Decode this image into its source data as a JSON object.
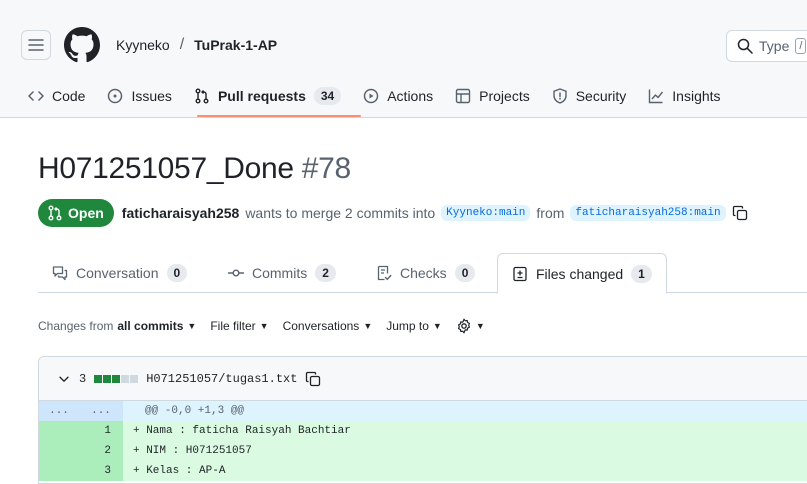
{
  "header": {
    "owner": "Kyyneko",
    "separator": "/",
    "repo": "TuPrak-1-AP",
    "search_placeholder": "Type",
    "search_key": "/"
  },
  "nav": {
    "code": "Code",
    "issues": "Issues",
    "pull_requests": "Pull requests",
    "pull_requests_count": "34",
    "actions": "Actions",
    "projects": "Projects",
    "security": "Security",
    "insights": "Insights"
  },
  "pr": {
    "title": "H071251057_Done",
    "number": "#78",
    "state": "Open",
    "author": "faticharaisyah258",
    "merge_text": "wants to merge 2 commits into",
    "base_branch": "Kyyneko:main",
    "from_text": "from",
    "head_branch": "faticharaisyah258:main"
  },
  "tabs": {
    "conversation": "Conversation",
    "conversation_count": "0",
    "commits": "Commits",
    "commits_count": "2",
    "checks": "Checks",
    "checks_count": "0",
    "files": "Files changed",
    "files_count": "1"
  },
  "toolbar": {
    "changes_from": "Changes from",
    "all_commits": "all commits",
    "file_filter": "File filter",
    "conversations": "Conversations",
    "jump_to": "Jump to"
  },
  "file": {
    "changes": "3",
    "path": "H071251057/tugas1.txt",
    "hunk_left": "...",
    "hunk_right": "...",
    "hunk_header": "@@ -0,0 +1,3 @@",
    "lines": [
      {
        "num": "1",
        "text": "+ Nama : faticha Raisyah Bachtiar"
      },
      {
        "num": "2",
        "text": "+ NIM : H071251057"
      },
      {
        "num": "3",
        "text": "+ Kelas : AP-A"
      }
    ]
  },
  "colors": {
    "open_green": "#1f883d",
    "branch_blue": "#0969da",
    "underline": "#fd8c73"
  }
}
